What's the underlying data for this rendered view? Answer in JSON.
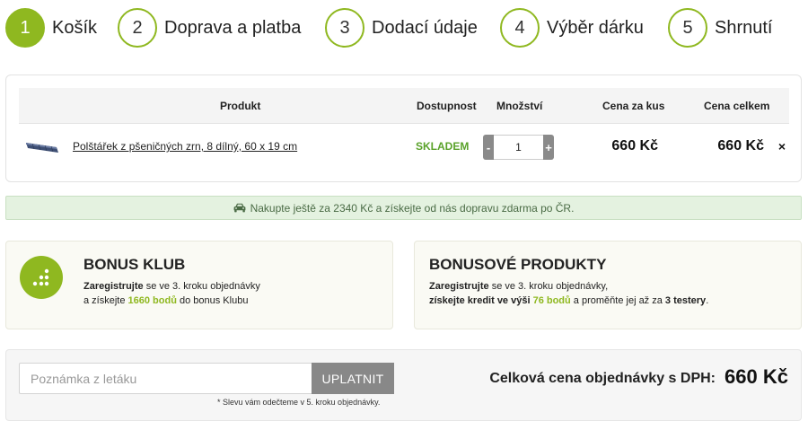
{
  "steps": [
    {
      "num": "1",
      "label": "Košík"
    },
    {
      "num": "2",
      "label": "Doprava a platba"
    },
    {
      "num": "3",
      "label": "Dodací údaje"
    },
    {
      "num": "4",
      "label": "Výběr dárku"
    },
    {
      "num": "5",
      "label": "Shrnutí"
    }
  ],
  "cart": {
    "headers": {
      "product": "Produkt",
      "availability": "Dostupnost",
      "quantity": "Množství",
      "unit_price": "Cena za kus",
      "total_price": "Cena celkem"
    },
    "item": {
      "name": "Polštářek z pšeničných zrn, 8 dílný, 60 x 19 cm",
      "availability": "SKLADEM",
      "quantity": "1",
      "minus": "-",
      "plus": "+",
      "unit_price": "660 Kč",
      "total_price": "660 Kč",
      "remove": "×"
    }
  },
  "shipping_banner": "Nakupte ještě za 2340 Kč a získejte od nás dopravu zdarma po ČR.",
  "bonus_klub": {
    "title": "BONUS KLUB",
    "register": "Zaregistrujte",
    "line1_rest": " se ve 3. kroku objednávky",
    "line2_pre": "a získejte ",
    "points": "1660 bodů",
    "line2_post": " do bonus Klubu"
  },
  "bonus_products": {
    "title": "BONUSOVÉ PRODUKTY",
    "register": "Zaregistrujte",
    "line1_rest": " se ve 3. kroku objednávky,",
    "line2_bold": "získejte kredit ve výši ",
    "points": "76 bodů",
    "line2_mid": " a proměňte jej až za ",
    "testers": "3 testery",
    "line2_end": "."
  },
  "note": {
    "placeholder": "Poznámka z letáku",
    "apply_label": "UPLATNIT",
    "discount_note": "* Slevu vám odečteme v 5. kroku objednávky."
  },
  "total": {
    "label": "Celková cena objednávky s DPH:",
    "value": "660 Kč"
  },
  "colors": {
    "accent": "#8fb820",
    "stock": "#5aa22a",
    "banner_bg": "#e4f2e0"
  }
}
